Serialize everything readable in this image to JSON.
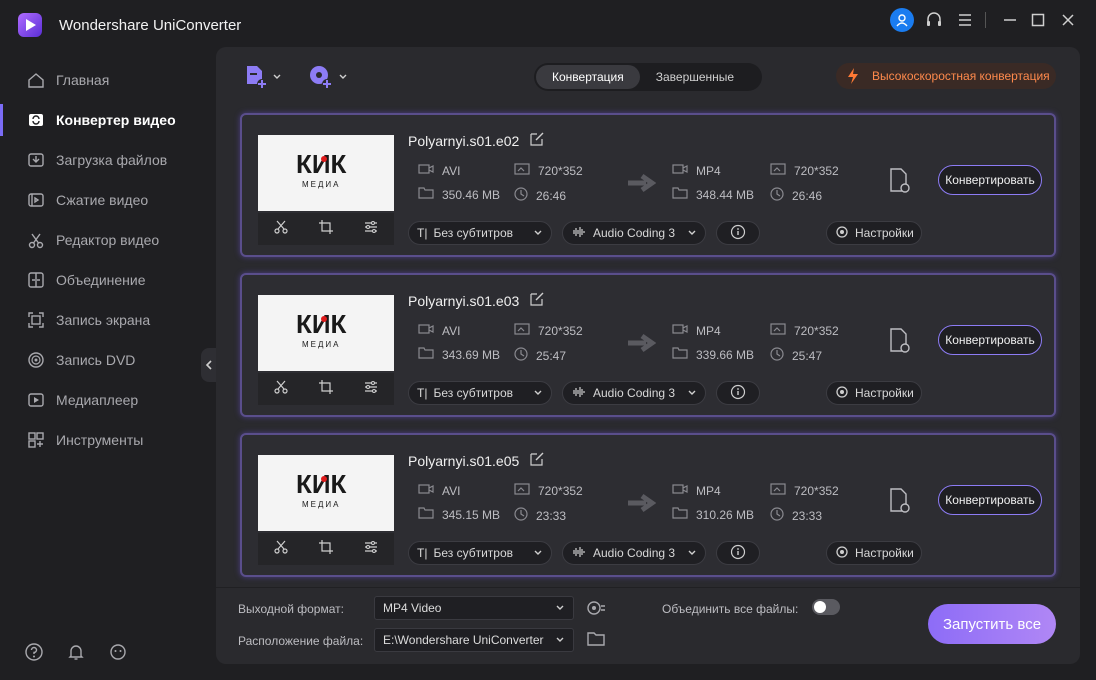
{
  "app": {
    "title": "Wondershare UniConverter"
  },
  "sidebar": {
    "items": [
      {
        "label": "Главная",
        "icon": "home-icon"
      },
      {
        "label": "Конвертер видео",
        "icon": "convert-icon",
        "active": true
      },
      {
        "label": "Загрузка файлов",
        "icon": "download-icon"
      },
      {
        "label": "Сжатие видео",
        "icon": "compress-icon"
      },
      {
        "label": "Редактор видео",
        "icon": "scissors-icon"
      },
      {
        "label": "Объединение",
        "icon": "merge-icon"
      },
      {
        "label": "Запись экрана",
        "icon": "screen-record-icon"
      },
      {
        "label": "Запись DVD",
        "icon": "dvd-icon"
      },
      {
        "label": "Медиаплеер",
        "icon": "player-icon"
      },
      {
        "label": "Инструменты",
        "icon": "tools-icon"
      }
    ]
  },
  "toolbar": {
    "tabs": [
      "Конвертация",
      "Завершенные"
    ],
    "high_speed": "Высокоскоростная конвертация"
  },
  "files": [
    {
      "name": "Polyarnyi.s01.e02",
      "src": {
        "format": "AVI",
        "res": "720*352",
        "size": "350.46 MB",
        "duration": "26:46"
      },
      "dst": {
        "format": "MP4",
        "res": "720*352",
        "size": "348.44 MB",
        "duration": "26:46"
      },
      "subtitle": "Без субтитров",
      "audio": "Audio Coding 3",
      "settings": "Настройки",
      "convert": "Конвертировать"
    },
    {
      "name": "Polyarnyi.s01.e03",
      "src": {
        "format": "AVI",
        "res": "720*352",
        "size": "343.69 MB",
        "duration": "25:47"
      },
      "dst": {
        "format": "MP4",
        "res": "720*352",
        "size": "339.66 MB",
        "duration": "25:47"
      },
      "subtitle": "Без субтитров",
      "audio": "Audio Coding 3",
      "settings": "Настройки",
      "convert": "Конвертировать"
    },
    {
      "name": "Polyarnyi.s01.e05",
      "src": {
        "format": "AVI",
        "res": "720*352",
        "size": "345.15 MB",
        "duration": "23:33"
      },
      "dst": {
        "format": "MP4",
        "res": "720*352",
        "size": "310.26 MB",
        "duration": "23:33"
      },
      "subtitle": "Без субтитров",
      "audio": "Audio Coding 3",
      "settings": "Настройки",
      "convert": "Конвертировать"
    }
  ],
  "thumb_logo": {
    "main": "КИК",
    "sub": "МЕДИА"
  },
  "bottom": {
    "output_label": "Выходной формат:",
    "output_value": "MP4 Video",
    "location_label": "Расположение файла:",
    "location_value": "E:\\Wondershare UniConverter",
    "merge_label": "Объединить все файлы:",
    "merge_on": false,
    "start": "Запустить все"
  },
  "colors": {
    "accent": "#8d7cf5",
    "orange": "#ff8a4c",
    "account": "#1a7cf0"
  }
}
